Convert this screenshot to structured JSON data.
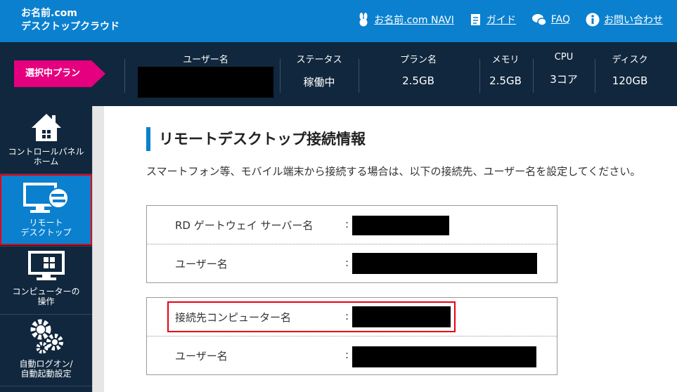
{
  "header": {
    "logo_line1": "お名前.com",
    "logo_line2": "デスクトップクラウド",
    "nav": [
      {
        "label": "お名前.com NAVI",
        "icon": "rabbit-icon"
      },
      {
        "label": "ガイド",
        "icon": "document-icon"
      },
      {
        "label": "FAQ",
        "icon": "chat-icon"
      },
      {
        "label": "お問い合わせ",
        "icon": "info-icon"
      }
    ]
  },
  "plan": {
    "badge": "選択中プラン",
    "username_label": "ユーザー名",
    "status_label": "ステータス",
    "status_value": "稼働中",
    "plan_label": "プラン名",
    "plan_value": "2.5GB",
    "memory_label": "メモリ",
    "memory_value": "2.5GB",
    "cpu_label": "CPU",
    "cpu_value": "3コア",
    "disk_label": "ディスク",
    "disk_value": "120GB"
  },
  "sidebar": {
    "items": [
      {
        "line1": "コントロールパネル",
        "line2": "ホーム",
        "icon": "home-icon"
      },
      {
        "line1": "リモート",
        "line2": "デスクトップ",
        "icon": "remote-desktop-icon"
      },
      {
        "line1": "コンピューターの",
        "line2": "操作",
        "icon": "monitor-icon"
      },
      {
        "line1": "自動ログオン/",
        "line2": "自動起動設定",
        "icon": "gears-icon"
      }
    ]
  },
  "main": {
    "title": "リモートデスクトップ接続情報",
    "description": "スマートフォン等、モバイル端末から接続する場合は、以下の接続先、ユーザー名を設定してください。",
    "box1": {
      "row1_label": "RD ゲートウェイ サーバー名",
      "row2_label": "ユーザー名"
    },
    "box2": {
      "row1_label": "接続先コンピューター名",
      "row2_label": "ユーザー名"
    },
    "colon": ":"
  },
  "colors": {
    "header_blue": "#0a80cf",
    "dark_navy": "#10273d",
    "badge_pink": "#e4007f",
    "highlight_red": "#e60012"
  }
}
